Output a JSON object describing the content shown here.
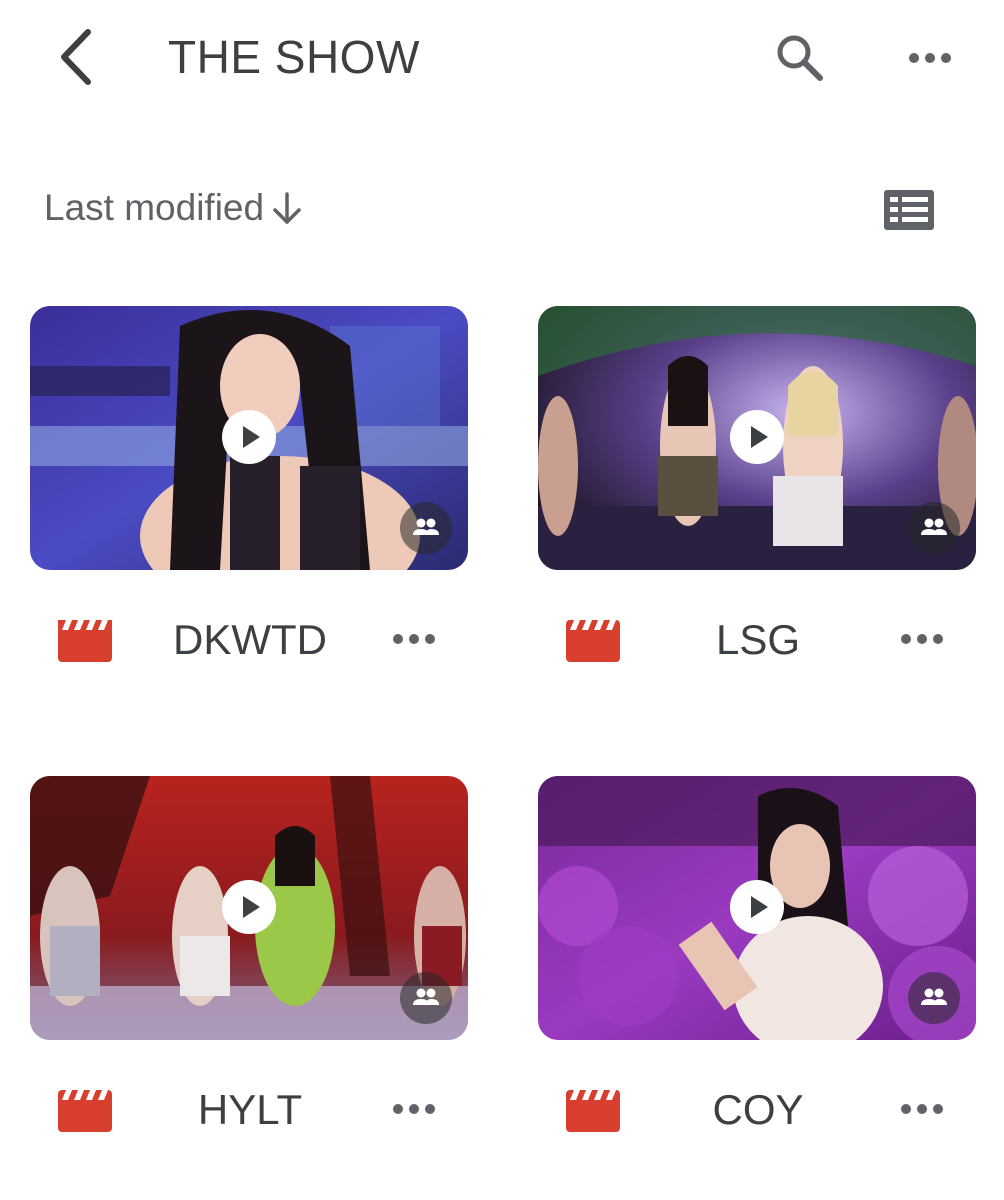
{
  "header": {
    "title": "THE SHOW",
    "back_icon": "chevron-left-icon",
    "search_icon": "search-icon",
    "more_icon": "more-horizontal-icon"
  },
  "sortbar": {
    "sort_label": "Last modified",
    "sort_direction_icon": "arrow-down-icon",
    "view_toggle_icon": "list-view-icon"
  },
  "files": [
    {
      "name": "DKWTD",
      "type_icon": "video-file-icon",
      "shared": true
    },
    {
      "name": "LSG",
      "type_icon": "video-file-icon",
      "shared": true
    },
    {
      "name": "HYLT",
      "type_icon": "video-file-icon",
      "shared": true
    },
    {
      "name": "COY",
      "type_icon": "video-file-icon",
      "shared": true
    }
  ],
  "colors": {
    "text": "#3c4043",
    "muted": "#5f6368",
    "video_icon": "#d93f2e"
  }
}
